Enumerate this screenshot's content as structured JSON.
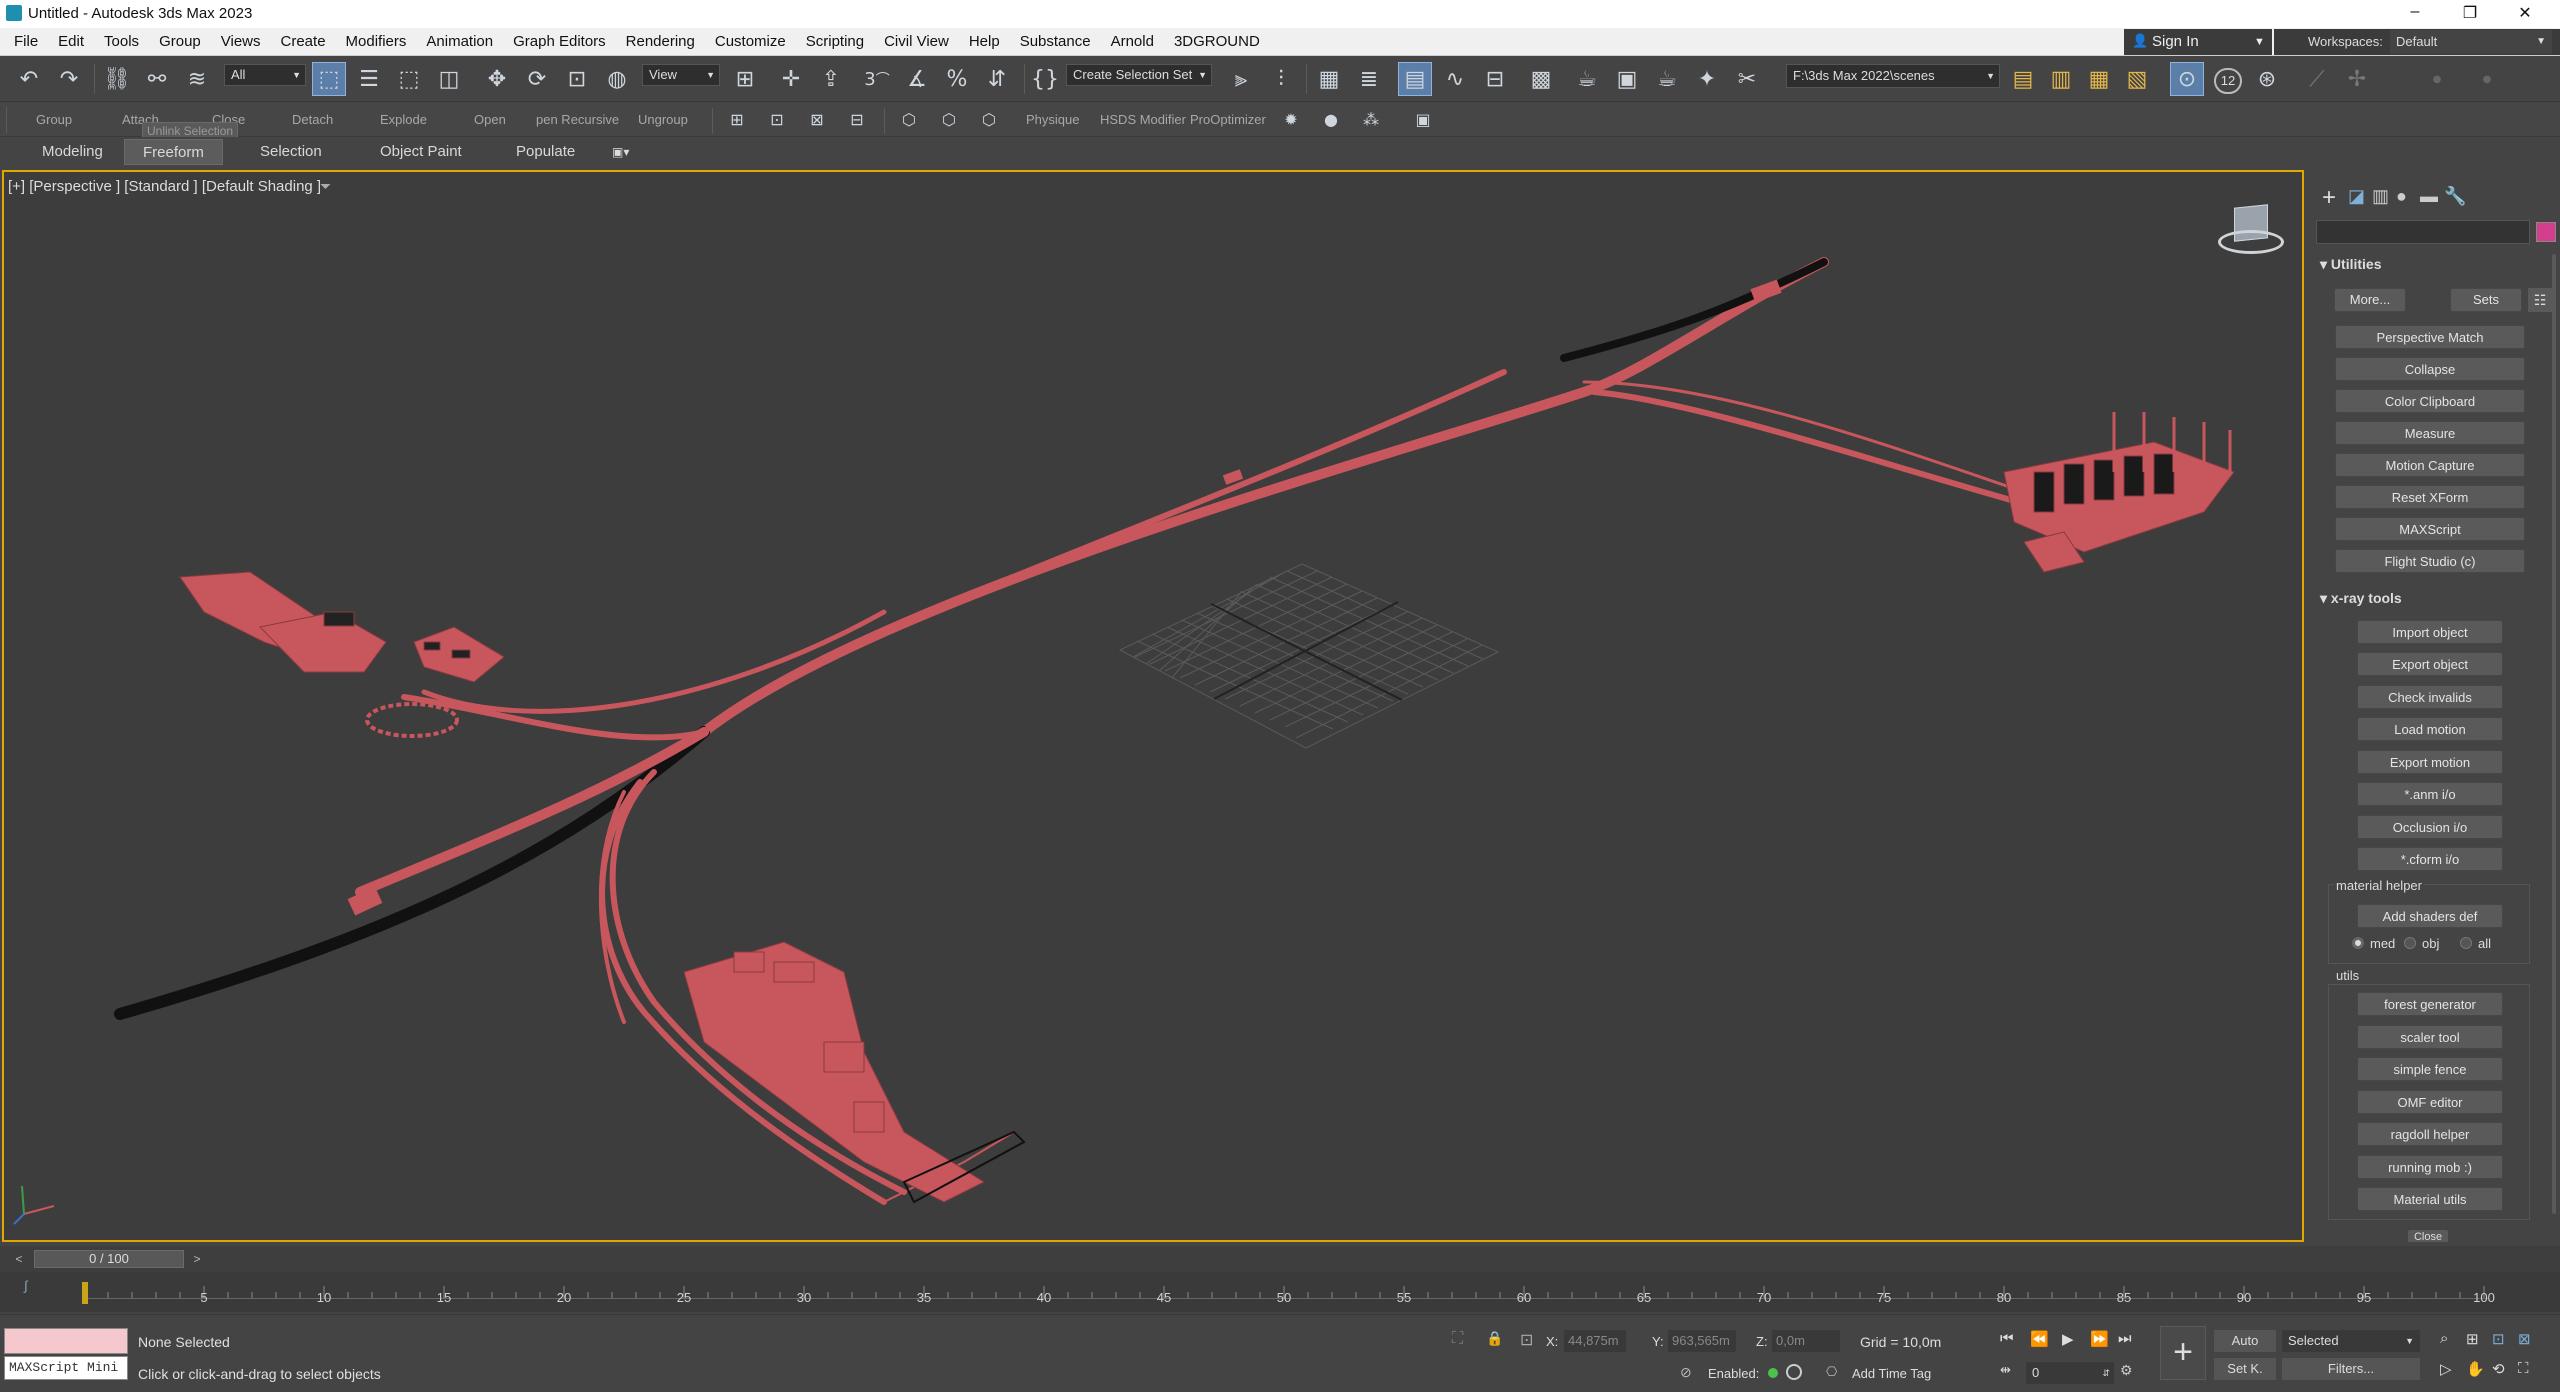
{
  "window": {
    "title": "Untitled - Autodesk 3ds Max 2023",
    "controls": [
      "–",
      "❐",
      "✕"
    ]
  },
  "menubar": {
    "items": [
      "File",
      "Edit",
      "Tools",
      "Group",
      "Views",
      "Create",
      "Modifiers",
      "Animation",
      "Graph Editors",
      "Rendering",
      "Customize",
      "Scripting",
      "Civil View",
      "Help",
      "Substance",
      "Arnold",
      "3DGROUND"
    ],
    "sign_in": "Sign In",
    "workspaces_label": "Workspaces:",
    "workspaces_value": "Default"
  },
  "toolbar": {
    "filter_value": "All",
    "ref_coord_value": "View",
    "selection_set_value": "Create Selection Set",
    "project_path": "F:\\3ds Max 2022\\scenes",
    "snaps_value": "3",
    "badge_12": "12"
  },
  "ribbon": {
    "labels": [
      "Group",
      "Attach",
      "Close",
      "Detach",
      "Explode",
      "Open",
      "pen Recursive",
      "Ungroup",
      "Physique",
      "HSDS Modifier",
      "ProOptimizer"
    ],
    "tooltip": "Unlink Selection",
    "tabs": [
      "Modeling",
      "Freeform",
      "Selection",
      "Object Paint",
      "Populate"
    ],
    "active_tab": "Freeform"
  },
  "viewport": {
    "label": "[+] [Perspective ] [Standard ] [Default Shading ]",
    "accent": "#c8575d"
  },
  "command_panel": {
    "utilities_title": "Utilities",
    "more_label": "More...",
    "sets_label": "Sets",
    "utilities": [
      "Perspective Match",
      "Collapse",
      "Color Clipboard",
      "Measure",
      "Motion Capture",
      "Reset XForm",
      "MAXScript",
      "Flight Studio (c)"
    ],
    "xray_title": "x-ray tools",
    "xray_buttons": [
      "Import object",
      "Export object",
      "Check invalids",
      "Load motion",
      "Export motion",
      "*.anm i/o",
      "Occlusion i/o",
      "*.cform i/o"
    ],
    "material_helper_title": "material helper",
    "add_shaders": "Add shaders def",
    "radio_options": [
      "med",
      "obj",
      "all"
    ],
    "radio_selected": "med",
    "utils_title": "utils",
    "utils_buttons": [
      "forest generator",
      "scaler tool",
      "simple fence",
      "OMF editor",
      "ragdoll helper",
      "running mob :)",
      "Material utils"
    ],
    "close_label": "Close"
  },
  "timeline": {
    "frame_display": "0 / 100",
    "ticks": [
      "5",
      "10",
      "15",
      "20",
      "25",
      "30",
      "35",
      "40",
      "45",
      "50",
      "55",
      "60",
      "65",
      "70",
      "75",
      "80",
      "85",
      "90",
      "95",
      "100"
    ],
    "current_frame": 0,
    "max_frame": 100
  },
  "status": {
    "maxscript_label": "MAXScript Mini",
    "selection": "None Selected",
    "prompt": "Click or click-and-drag to select objects",
    "x_label": "X:",
    "x_value": "44,875m",
    "y_label": "Y:",
    "y_value": "963,565m",
    "z_label": "Z:",
    "z_value": "0,0m",
    "grid": "Grid = 10,0m",
    "enabled_label": "Enabled:",
    "add_time_tag": "Add Time Tag",
    "auto_label": "Auto",
    "set_key_label": "Set K.",
    "selected_value": "Selected",
    "filters_label": "Filters...",
    "frame_value": "0"
  }
}
